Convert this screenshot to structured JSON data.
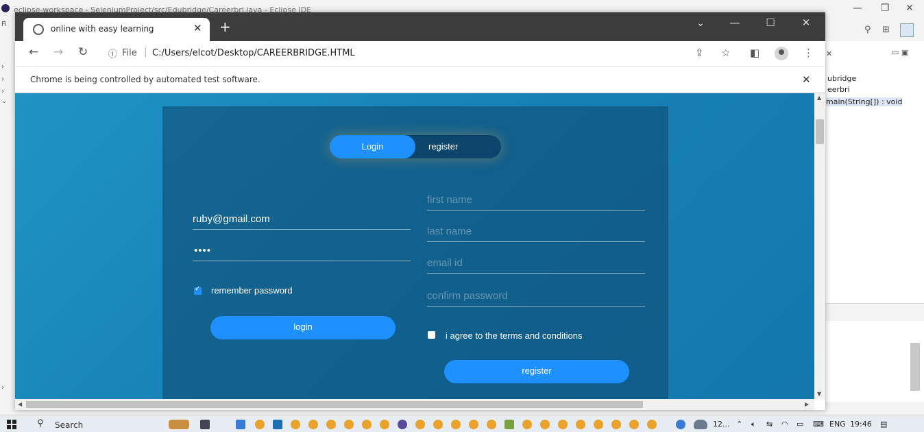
{
  "eclipse": {
    "title": "eclipse-workspace - SeleniumProject/src/Edubridge/Careerbri.java - Eclipse IDE",
    "menu_first": "Fi",
    "outline": [
      "ubridge",
      "eerbri",
      "main(String[]) : void"
    ]
  },
  "chrome": {
    "tab_title": "online with easy learning",
    "new_tab": "+",
    "omnibox": {
      "scheme_label": "File",
      "separator": "|",
      "url": "C:/Users/elcot/Desktop/CAREERBRIDGE.HTML"
    },
    "infobar": "Chrome is being controlled by automated test software."
  },
  "page": {
    "toggle": {
      "login": "Login",
      "register": "register"
    },
    "login_form": {
      "email_value": "ruby@gmail.com",
      "password_dots": "••••",
      "remember_label": "remember password",
      "remember_checked": true,
      "login_button": "login"
    },
    "register_form": {
      "first_name_placeholder": "first name",
      "last_name_placeholder": "last name",
      "email_placeholder": "email id",
      "confirm_placeholder": "confirm password",
      "terms_label": "i agree to the terms and conditions",
      "terms_checked": false,
      "register_button": "register"
    }
  },
  "taskbar": {
    "search_label": "Search",
    "weather": "12...",
    "lang": "ENG",
    "time": "19:46"
  },
  "colors": {
    "accent": "#1e90ff",
    "page_bg": "#1680b4",
    "panel_bg": "#0e466e"
  }
}
